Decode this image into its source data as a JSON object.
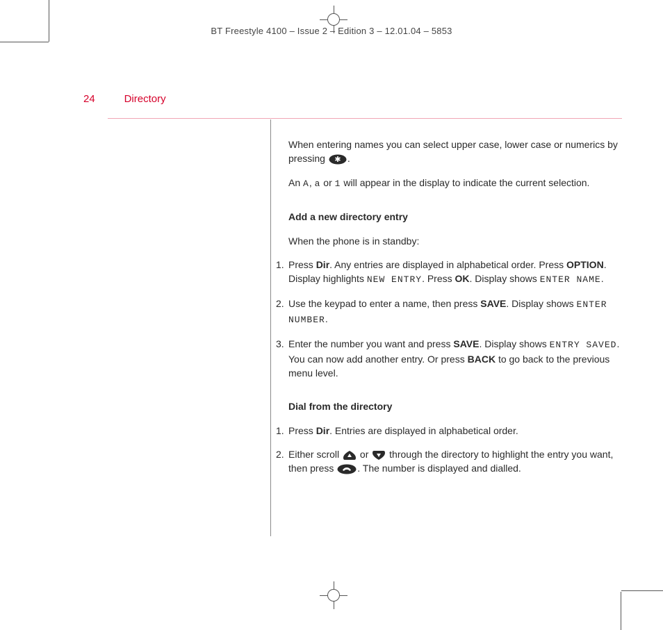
{
  "meta": {
    "doc_header": "BT Freestyle 4100 – Issue 2 – Edition 3 – 12.01.04 – 5853"
  },
  "page": {
    "number": "24",
    "section": "Directory"
  },
  "body": {
    "intro1_a": "When entering names you can select upper case, lower case or numerics by pressing ",
    "intro1_b": ".",
    "intro2_a": "An ",
    "intro2_A": "A",
    "intro2_c": ", ",
    "intro2_a2": "a",
    "intro2_or": " or ",
    "intro2_1": "1",
    "intro2_tail": " will appear in the display to indicate the current selection.",
    "h_add": "Add a new directory entry",
    "add_intro": "When the phone is in standby:",
    "add_steps": {
      "s1_a": "Press ",
      "s1_dir": "Dir",
      "s1_b": ". Any entries are displayed in alphabetical order. Press ",
      "s1_option": "OPTION",
      "s1_c": ". Display highlights ",
      "s1_newentry": "NEW ENTRY",
      "s1_d": ". Press ",
      "s1_ok": "OK",
      "s1_e": ". Display shows ",
      "s1_entername": "ENTER NAME",
      "s1_f": ".",
      "s2_a": "Use the keypad to enter a name, then press ",
      "s2_save": "SAVE",
      "s2_b": ". Display shows ",
      "s2_enternum": "ENTER NUMBER",
      "s2_c": ".",
      "s3_a": "Enter the number you want and press ",
      "s3_save": "SAVE",
      "s3_b": ". Display shows ",
      "s3_saved": "ENTRY SAVED",
      "s3_c": ". You can now add another entry. Or press ",
      "s3_back": "BACK",
      "s3_d": " to go back to the previous menu level."
    },
    "h_dial": "Dial from the directory",
    "dial_steps": {
      "s1_a": "Press ",
      "s1_dir": "Dir",
      "s1_b": ". Entries are displayed in alphabetical order.",
      "s2_a": "Either scroll ",
      "s2_b": " or ",
      "s2_c": " through the directory to highlight the entry you want, then press ",
      "s2_d": ". The number is displayed and dialled."
    }
  },
  "icons": {
    "star": "star-key-icon",
    "up": "up-key-icon",
    "down": "down-key-icon",
    "talk": "talk-key-icon"
  }
}
